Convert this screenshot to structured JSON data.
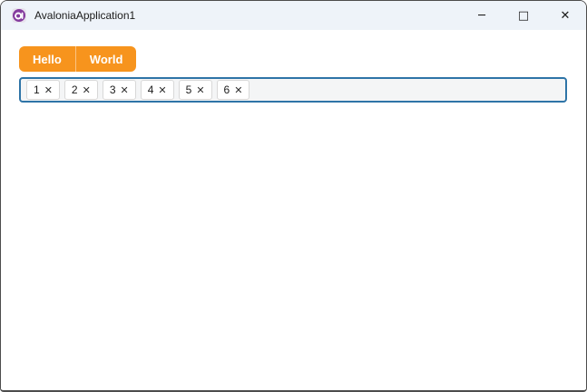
{
  "window": {
    "title": "AvaloniaApplication1",
    "icons": {
      "minimize": "─",
      "maximize": "□",
      "close": "✕"
    }
  },
  "tabs": [
    {
      "label": "Hello"
    },
    {
      "label": "World"
    }
  ],
  "chip_input": {
    "chips": [
      {
        "label": "1"
      },
      {
        "label": "2"
      },
      {
        "label": "3"
      },
      {
        "label": "4"
      },
      {
        "label": "5"
      },
      {
        "label": "6"
      }
    ],
    "remove_icon": "✕"
  },
  "colors": {
    "accent_orange": "#F7941D",
    "focus_border_blue": "#2E74A7",
    "titlebar": "#EEF3F9",
    "logo_purple": "#843B9E"
  }
}
